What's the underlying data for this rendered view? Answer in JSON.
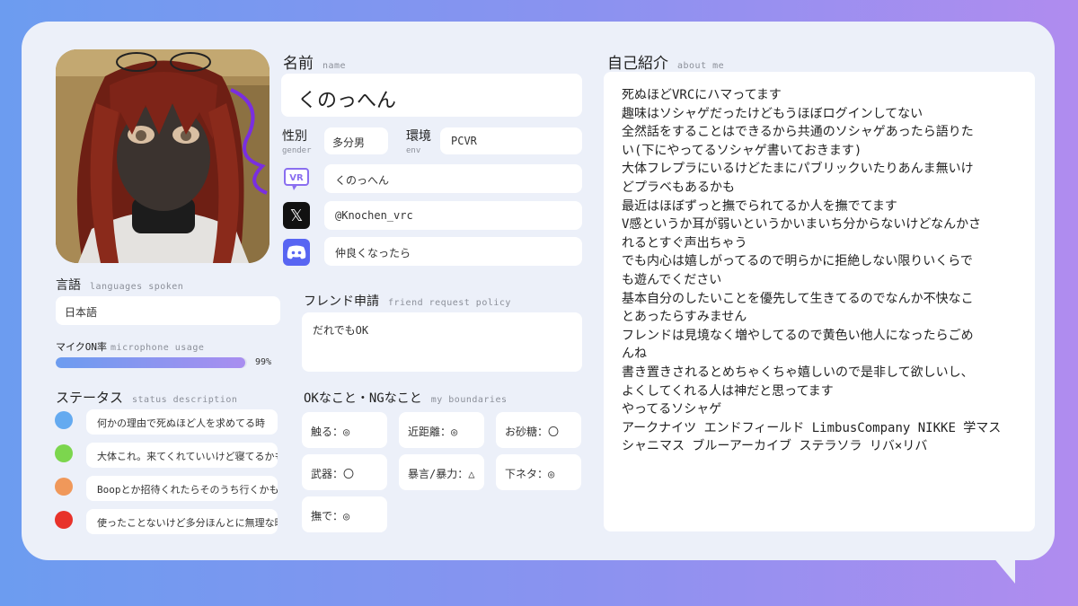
{
  "profile": {
    "name_label": "名前",
    "name_label_en": "name",
    "name": "くのっへん",
    "gender_label": "性別",
    "gender_label_en": "gender",
    "gender": "多分男",
    "env_label": "環境",
    "env_label_en": "env",
    "env": "PCVR",
    "vrchat_icon": "vrchat-icon",
    "vrchat": "くのっへん",
    "x_icon": "x-logo-icon",
    "x_account": "@Knochen_vrc",
    "discord_icon": "discord-icon",
    "discord": "仲良くなったら"
  },
  "languages": {
    "label": "言語",
    "label_en": "languages spoken",
    "value": "日本語"
  },
  "mic": {
    "label": "マイクON率",
    "label_en": "microphone usage",
    "percent_text": "99%",
    "percent": 99
  },
  "status": {
    "label": "ステータス",
    "label_en": "status description",
    "items": [
      {
        "color": "#64aaf0",
        "text": "何かの理由で死ぬほど人を求めてる時"
      },
      {
        "color": "#7cd64e",
        "text": "大体これ。来てくれていいけど寝てるかも"
      },
      {
        "color": "#f0985a",
        "text": "Boopとか招待くれたらそのうち行くかも"
      },
      {
        "color": "#e8322a",
        "text": "使ったことないけど多分ほんとに無理な時"
      }
    ]
  },
  "friend_request": {
    "label": "フレンド申請",
    "label_en": "friend request policy",
    "value": "だれでもOK"
  },
  "boundaries": {
    "label": "OKなこと・NGなこと",
    "label_en": "my boundaries",
    "items": [
      "触る：◎",
      "近距離：◎",
      "お砂糖：〇",
      "武器：〇",
      "暴言/暴力：△",
      "下ネタ：◎",
      "撫で：◎"
    ]
  },
  "about": {
    "label": "自己紹介",
    "label_en": "about me",
    "lines": [
      "死ぬほどVRCにハマってます",
      "趣味はソシャゲだったけどもうほぼログインしてない",
      "全然話をすることはできるから共通のソシャゲあったら語りた",
      "い(下にやってるソシャゲ書いておきます)",
      "大体フレプラにいるけどたまにパブリックいたりあんま無いけ",
      "どプラベもあるかも",
      "最近はほぼずっと撫でられてるか人を撫でてます",
      "V感というか耳が弱いというかいまいち分からないけどなんかさ",
      "れるとすぐ声出ちゃう",
      "でも内心は嬉しがってるので明らかに拒絶しない限りいくらで",
      "も遊んでください",
      "基本自分のしたいことを優先して生きてるのでなんか不快なこ",
      "とあったらすみません",
      "フレンドは見境なく増やしてるので黄色い他人になったらごめ",
      "んね",
      "書き置きされるとめちゃくちゃ嬉しいので是非して欲しいし、",
      "よくしてくれる人は神だと思ってます",
      "やってるソシャゲ",
      "アークナイツ エンドフィールド LimbusCompany NIKKE 学マス",
      "シャニマス ブルーアーカイブ ステラソラ リバ×リバ"
    ]
  }
}
